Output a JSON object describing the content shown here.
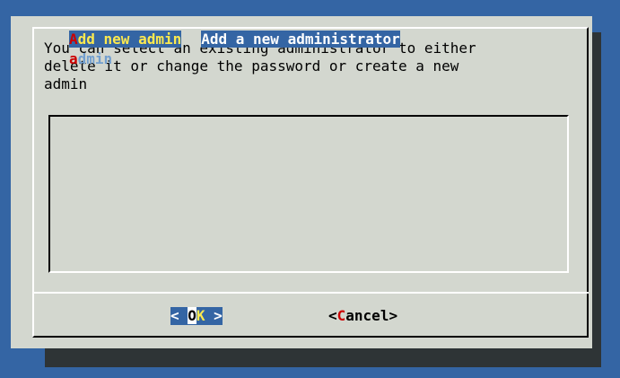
{
  "dialog": {
    "message": "You can select an existing administrator to either\ndelete it or change the password or create a new\nadmin"
  },
  "menu": {
    "items": [
      {
        "tag_hotkey": "A",
        "tag_rest": "dd new admin",
        "description": "Add a new administrator",
        "selected": true
      },
      {
        "tag_hotkey": "a",
        "tag_rest": "dmin",
        "description": "",
        "selected": false
      }
    ]
  },
  "buttons": {
    "ok": {
      "left": "< ",
      "hotkey": "O",
      "rest": "K",
      "right": " >"
    },
    "cancel": {
      "left": "<",
      "hotkey": "C",
      "rest": "ancel",
      "right": ">"
    }
  },
  "colors": {
    "background": "#3465a4",
    "dialog": "#d3d7cf",
    "selection": "#3465a4",
    "hotkey": "#cc0000",
    "selected_tag": "#fce94f",
    "unselected_tag": "#729fcf"
  }
}
